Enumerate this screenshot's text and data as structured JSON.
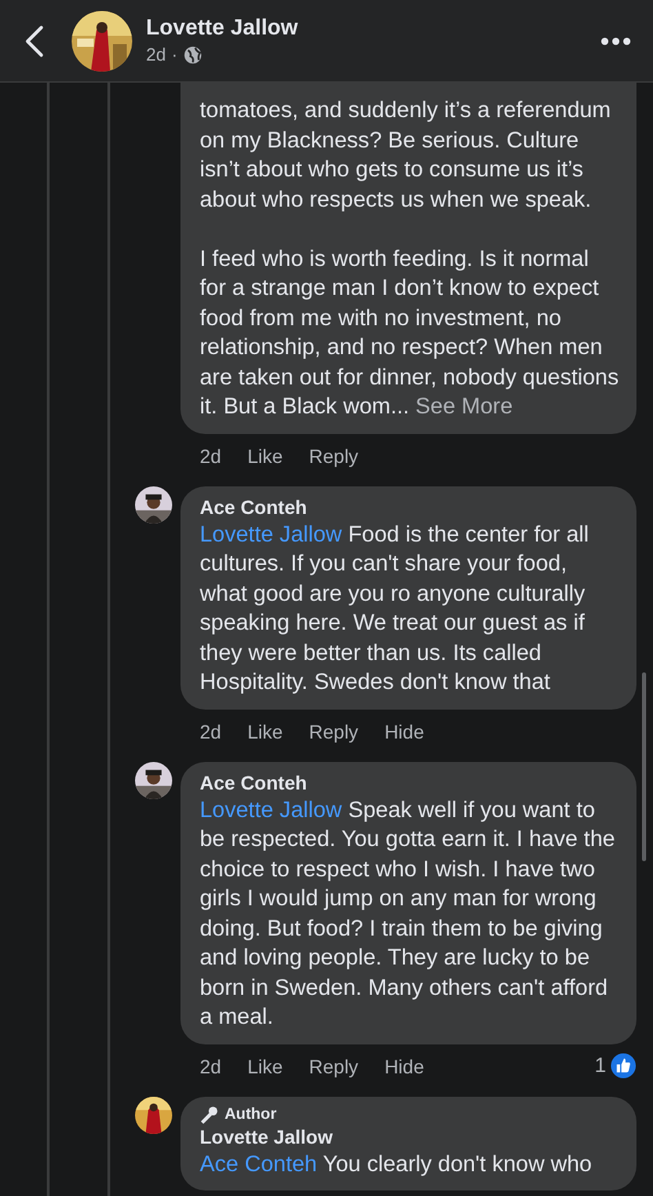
{
  "header": {
    "name": "Lovette Jallow",
    "time": "2d",
    "separator": "·"
  },
  "comments": [
    {
      "paragraphs": [
        "tomatoes, and suddenly it’s a referendum on my Blackness? Be serious. Culture isn’t about who gets to consume us it’s about who respects us when we speak.",
        "I feed who is worth feeding. Is it normal for a strange man I don’t know to expect food from me with no investment, no relationship, and no respect? When men are taken out for dinner, nobody questions it. But a Black wom..."
      ],
      "see_more": "See More",
      "time": "2d",
      "actions": [
        "Like",
        "Reply"
      ]
    },
    {
      "author": "Ace Conteh",
      "mention": "Lovette Jallow",
      "paragraphs": [
        "Food is the center for all cultures. If you can't share your food, what good are you ro anyone culturally speaking here. We treat our guest as if they were better than us. Its called Hospitality. Swedes don't know that"
      ],
      "time": "2d",
      "actions": [
        "Like",
        "Reply",
        "Hide"
      ]
    },
    {
      "author": "Ace Conteh",
      "mention": "Lovette Jallow",
      "paragraphs": [
        "Speak well if you want to be respected. You gotta earn it. I have the choice to respect who I wish. I have two girls I would jump on any man for wrong doing. But food? I train them to be giving and loving people.  They are lucky to be born in Sweden. Many others can't afford a meal."
      ],
      "time": "2d",
      "actions": [
        "Like",
        "Reply",
        "Hide"
      ],
      "reactions": "1"
    },
    {
      "author": "Lovette Jallow",
      "badge": "Author",
      "mention": "Ace Conteh",
      "paragraphs": [
        "You clearly don't know who"
      ]
    }
  ]
}
